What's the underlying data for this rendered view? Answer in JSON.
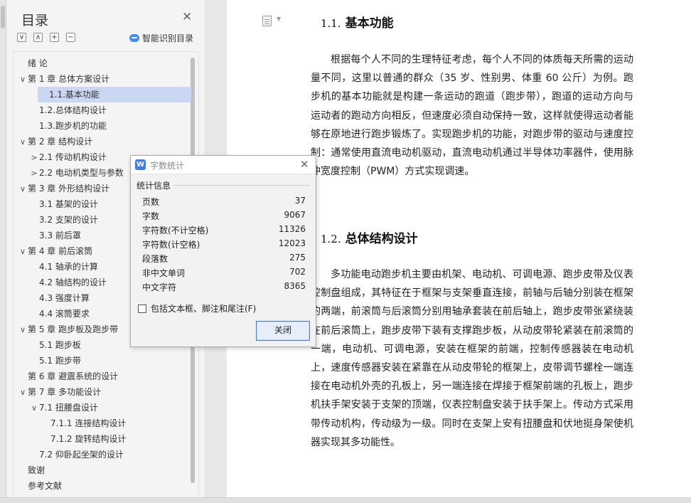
{
  "toc": {
    "title": "目录",
    "smart_label": "智能识别目录",
    "tools": [
      "∨",
      "∧",
      "+",
      "−"
    ],
    "items": [
      {
        "label": "绪  论",
        "level": 1,
        "caret": ""
      },
      {
        "label": "第 1 章    总体方案设计",
        "level": 1,
        "caret": "∨"
      },
      {
        "label": "1.1.基本功能",
        "level": 2,
        "caret": "",
        "selected": true
      },
      {
        "label": "1.2.总体结构设计",
        "level": 2,
        "caret": ""
      },
      {
        "label": "1.3.跑步机的功能",
        "level": 2,
        "caret": ""
      },
      {
        "label": "第 2 章    结构设计",
        "level": 1,
        "caret": "∨"
      },
      {
        "label": "2.1  传动机构设计",
        "level": 2,
        "caret": ">"
      },
      {
        "label": "2.2  电动机类型与参数",
        "level": 2,
        "caret": ">"
      },
      {
        "label": "第 3 章  外形结构设计",
        "level": 1,
        "caret": "∨"
      },
      {
        "label": "3.1 基架的设计",
        "level": 2,
        "caret": ""
      },
      {
        "label": "3.2 支架的设计",
        "level": 2,
        "caret": ""
      },
      {
        "label": "3.3 前后罩",
        "level": 2,
        "caret": ""
      },
      {
        "label": "第 4 章  前后滚筒",
        "level": 1,
        "caret": "∨"
      },
      {
        "label": "4.1 轴承的计算",
        "level": 2,
        "caret": ""
      },
      {
        "label": "4.2 轴结构的设计",
        "level": 2,
        "caret": ""
      },
      {
        "label": "4.3 强度计算",
        "level": 2,
        "caret": ""
      },
      {
        "label": "4.4 滚筒要求",
        "level": 2,
        "caret": ""
      },
      {
        "label": "第 5 章    跑步板及跑步带",
        "level": 1,
        "caret": "∨"
      },
      {
        "label": "5.1 跑步板",
        "level": 2,
        "caret": ""
      },
      {
        "label": "5.1 跑步带",
        "level": 2,
        "caret": ""
      },
      {
        "label": "第 6 章  避震系统的设计",
        "level": 1,
        "caret": ""
      },
      {
        "label": "第 7 章  多功能设计",
        "level": 1,
        "caret": "∨"
      },
      {
        "label": "7.1 扭腰盘设计",
        "level": 2,
        "caret": "∨"
      },
      {
        "label": "7.1.1 连接结构设计",
        "level": 3,
        "caret": ""
      },
      {
        "label": "7.1.2 旋转结构设计",
        "level": 3,
        "caret": ""
      },
      {
        "label": "7.2  仰卧起坐架的设计",
        "level": 2,
        "caret": ""
      },
      {
        "label": "致谢",
        "level": 1,
        "caret": ""
      },
      {
        "label": "参考文献",
        "level": 1,
        "caret": ""
      }
    ]
  },
  "document": {
    "section1": {
      "num": "1.1.",
      "title": "基本功能"
    },
    "para1": "根据每个人不同的生理特征考虑，每个人不同的体质每天所需的运动量不同，这里以普通的群众（35 岁、性别男、体重 60 公斤）为例。跑步机的基本功能就是构建一条运动的跑道（跑步带），跑道的运动方向与运动者的跑动方向相反，但速度必须自动保持一致，这样就使得运动者能够在原地进行跑步锻炼了。实现跑步机的功能，对跑步带的驱动与速度控制：通常使用直流电动机驱动，直流电动机通过半导体功率器件，使用脉冲宽度控制（PWM）方式实现调速。",
    "section2": {
      "num": "1.2.",
      "title": "总体结构设计"
    },
    "para2": "多功能电动跑步机主要由机架、电动机、可调电源、跑步皮带及仪表控制盘组成，其特征在于框架与支架垂直连接，前轴与后轴分别装在框架的两端，前滚筒与后滚筒分别用轴承套装在前后轴上，跑步皮带张紧绕装在前后滚筒上，跑步皮带下装有支撑跑步板，从动皮带轮紧装在前滚筒的一端，电动机、可调电源，安装在框架的前端，控制传感器装在电动机上，速度传感器安装在紧靠在从动皮带轮的框架上，皮带调节螺栓一端连接在电动机外壳的孔板上，另一端连接在焊接于框架前端的孔板上，跑步机扶手架安装于支架的顶端，仪表控制盘安装于扶手架上。传动方式采用带传动机构，传动级为一级。同时在支架上安有扭腰盘和伏地挺身架使机器实现其多功能性。"
  },
  "dialog": {
    "title": "字数统计",
    "group_label": "统计信息",
    "stats": [
      {
        "label": "页数",
        "value": "37"
      },
      {
        "label": "字数",
        "value": "9067"
      },
      {
        "label": "字符数(不计空格)",
        "value": "11326"
      },
      {
        "label": "字符数(计空格)",
        "value": "12023"
      },
      {
        "label": "段落数",
        "value": "275"
      },
      {
        "label": "非中文单词",
        "value": "702"
      },
      {
        "label": "中文字符",
        "value": "8365"
      }
    ],
    "checkbox_label": "包括文本框、脚注和尾注(F)",
    "close_button": "关闭"
  }
}
